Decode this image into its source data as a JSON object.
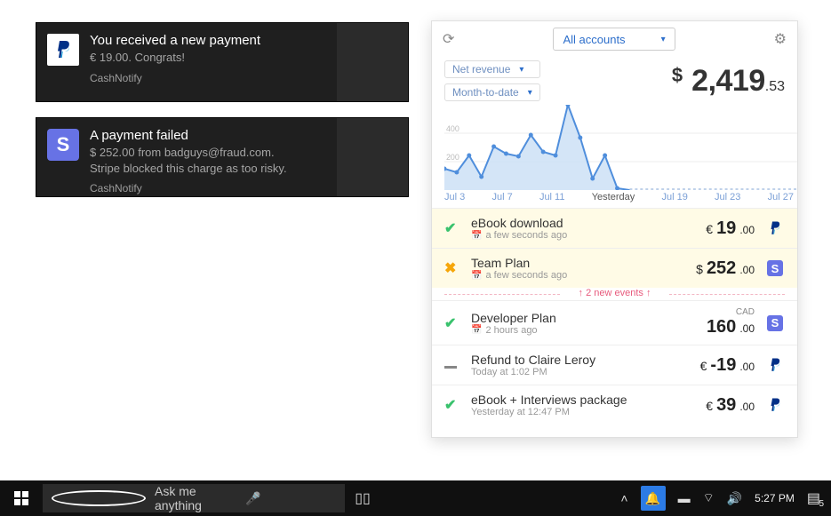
{
  "toasts": [
    {
      "title": "You received a new payment",
      "line1": "€ 19.00. Congrats!",
      "line2": "",
      "app": "CashNotify",
      "icon": "paypal"
    },
    {
      "title": "A payment failed",
      "line1": "$ 252.00 from badguys@fraud.com.",
      "line2": "Stripe blocked this charge as too risky.",
      "app": "CashNotify",
      "icon": "stripe"
    }
  ],
  "panel": {
    "account_dropdown": "All accounts",
    "filter_metric": "Net revenue",
    "filter_range": "Month-to-date",
    "total": {
      "symbol": "$",
      "whole": "2,419",
      "cents": ".53"
    },
    "xaxis": [
      "Jul 3",
      "Jul 7",
      "Jul 11",
      "Yesterday",
      "Jul 19",
      "Jul 23",
      "Jul 27"
    ],
    "new_events_label": "↑  2 new events  ↑"
  },
  "transactions": [
    {
      "status": "ok",
      "name": "eBook download",
      "time": "a few seconds ago",
      "currency_note": "",
      "symbol": "€",
      "whole": "19",
      "cents": ".00",
      "provider": "paypal",
      "highlight": true
    },
    {
      "status": "fail",
      "name": "Team Plan",
      "time": "a few seconds ago",
      "currency_note": "",
      "symbol": "$",
      "whole": "252",
      "cents": ".00",
      "provider": "stripe",
      "highlight": true
    },
    {
      "status": "ok",
      "name": "Developer Plan",
      "time": "2 hours ago",
      "currency_note": "CAD",
      "symbol": "",
      "whole": "160",
      "cents": ".00",
      "provider": "stripe",
      "highlight": false
    },
    {
      "status": "minus",
      "name": "Refund to Claire Leroy",
      "time": "Today at 1:02 PM",
      "currency_note": "",
      "symbol": "€",
      "whole": "-19",
      "cents": ".00",
      "provider": "paypal",
      "highlight": false
    },
    {
      "status": "ok",
      "name": "eBook + Interviews package",
      "time": "Yesterday at 12:47 PM",
      "currency_note": "",
      "symbol": "€",
      "whole": "39",
      "cents": ".00",
      "provider": "paypal",
      "highlight": false
    }
  ],
  "taskbar": {
    "search_placeholder": "Ask me anything",
    "clock": "5:27 PM",
    "notif_count": "5"
  },
  "chart_data": {
    "type": "line",
    "title": "",
    "xlabel": "",
    "ylabel": "",
    "ylim": [
      0,
      600
    ],
    "y_ticks": [
      200,
      400
    ],
    "x_ticks": [
      "Jul 3",
      "Jul 7",
      "Jul 11",
      "Yesterday",
      "Jul 19",
      "Jul 23",
      "Jul 27"
    ],
    "series": [
      {
        "name": "Net revenue",
        "x_index": [
          0,
          1,
          2,
          3,
          4,
          5,
          6,
          7,
          8,
          9,
          10,
          11,
          12,
          13,
          14,
          15
        ],
        "values": [
          150,
          120,
          240,
          90,
          300,
          250,
          230,
          380,
          260,
          240,
          600,
          370,
          80,
          240,
          10,
          0
        ]
      }
    ],
    "note": "values estimated from gridlines; 0-values after 'Yesterday' indicate future dates with no data"
  }
}
